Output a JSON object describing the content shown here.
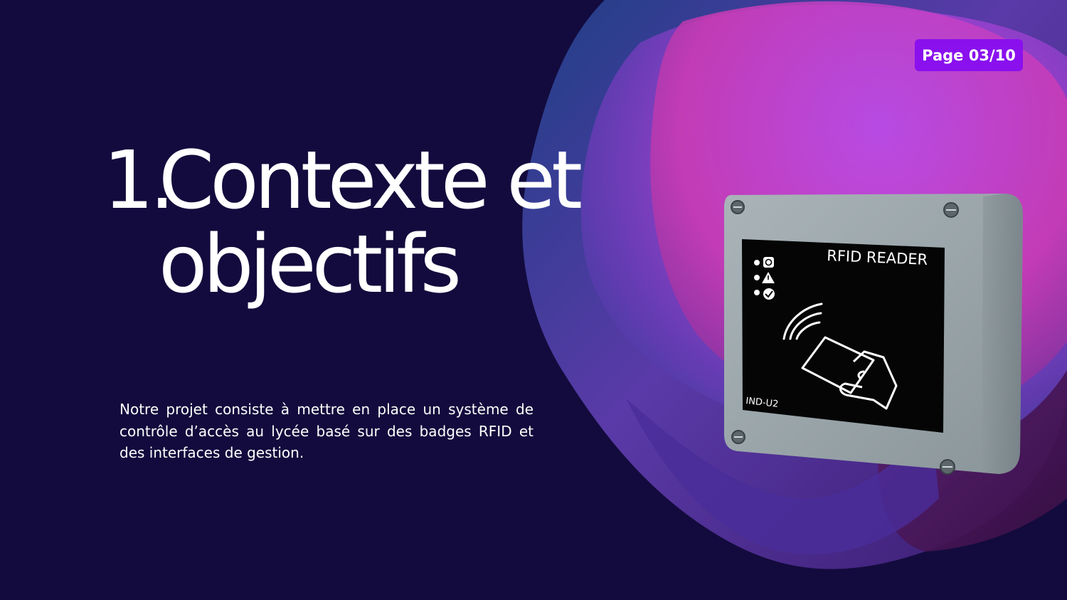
{
  "slide": {
    "page_indicator": "Page 03/10",
    "title_number": "1.",
    "title_line1": "Contexte et",
    "title_line2": "objectifs",
    "description": "Notre projet consiste à mettre en place un système de contrôle d’accès au lycée basé sur des badges RFID et des interfaces de gestion."
  },
  "device": {
    "label": "RFID READER",
    "model": "IND-U2",
    "status_icons": [
      "power-icon",
      "warning-icon",
      "check-icon"
    ]
  },
  "colors": {
    "background": "#130b3d",
    "badge": "#8a10ee",
    "accent_purple": "#b84ae8",
    "accent_magenta": "#d0349c",
    "accent_blue": "#2a4a9a"
  }
}
